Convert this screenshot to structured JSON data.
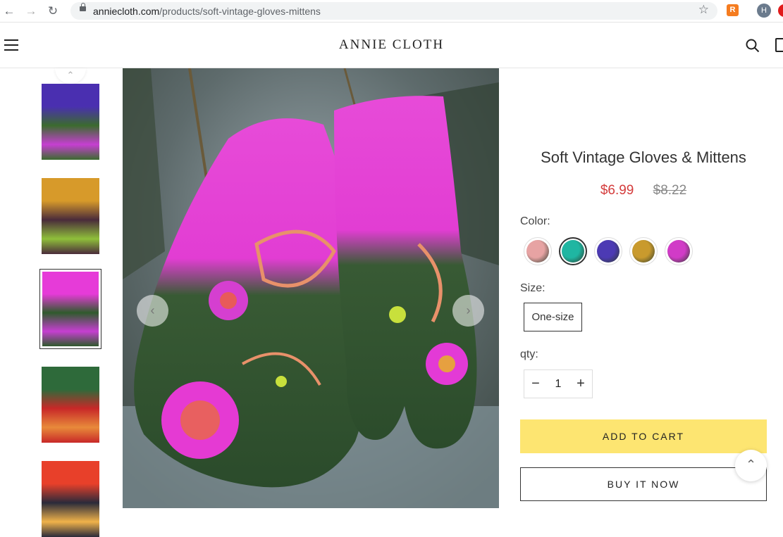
{
  "browser": {
    "url_host": "anniecloth.com",
    "url_path": "/products/soft-vintage-gloves-mittens",
    "back_icon": "arrow-left-icon",
    "forward_icon": "arrow-right-icon",
    "reload_icon": "reload-icon",
    "star_icon": "star-icon",
    "profile_initial": "H"
  },
  "header": {
    "logo": "ANNIE CLOTH",
    "menu_icon": "hamburger-icon",
    "search_icon": "search-icon",
    "cart_icon": "cart-icon"
  },
  "gallery": {
    "thumbnails": [
      {
        "colors": [
          "#4a2fb0",
          "#3b6b2e",
          "#c63fd1"
        ]
      },
      {
        "colors": [
          "#d79a2a",
          "#4a2b3a",
          "#8fbf3a"
        ]
      },
      {
        "colors": [
          "#e63bd8",
          "#2f5a2c",
          "#c63fd1"
        ]
      },
      {
        "colors": [
          "#2e6a3a",
          "#c82828",
          "#e88a3a"
        ]
      },
      {
        "colors": [
          "#e8402a",
          "#2a2a3a",
          "#f0b24a"
        ]
      }
    ],
    "active_index": 2,
    "prev_icon": "chevron-left-icon",
    "next_icon": "chevron-right-icon",
    "up_icon": "chevron-up-icon"
  },
  "product": {
    "title": "Soft Vintage Gloves & Mittens",
    "price": "$6.99",
    "compare_price": "$8.22",
    "color_label": "Color:",
    "colors": [
      {
        "name": "pink",
        "hex": "#e7a3a3"
      },
      {
        "name": "teal",
        "hex": "#1fb6a2"
      },
      {
        "name": "purple",
        "hex": "#4c3ab4"
      },
      {
        "name": "orange",
        "hex": "#c99a2d"
      },
      {
        "name": "magenta",
        "hex": "#d13bc7"
      }
    ],
    "selected_color_index": 1,
    "size_label": "Size:",
    "size_value": "One-size",
    "qty_label": "qty:",
    "qty_value": "1",
    "add_to_cart": "ADD TO CART",
    "buy_now": "BUY IT NOW",
    "add_to_cart_color": "#fde571"
  }
}
